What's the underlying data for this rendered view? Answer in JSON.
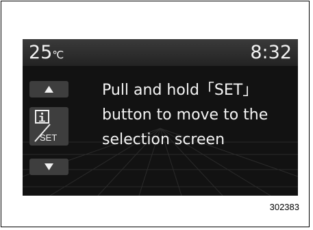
{
  "display": {
    "temperature": "25",
    "temperature_unit": "℃",
    "clock": "8:32",
    "message": "Pull and hold「SET」\nbutton to move to the\nselection screen",
    "info_button_label": "SET"
  },
  "figure_number": "302383",
  "colors": {
    "screen_background": "#121212",
    "button_background": "#3e3e3e",
    "text": "#f5f5f5"
  }
}
